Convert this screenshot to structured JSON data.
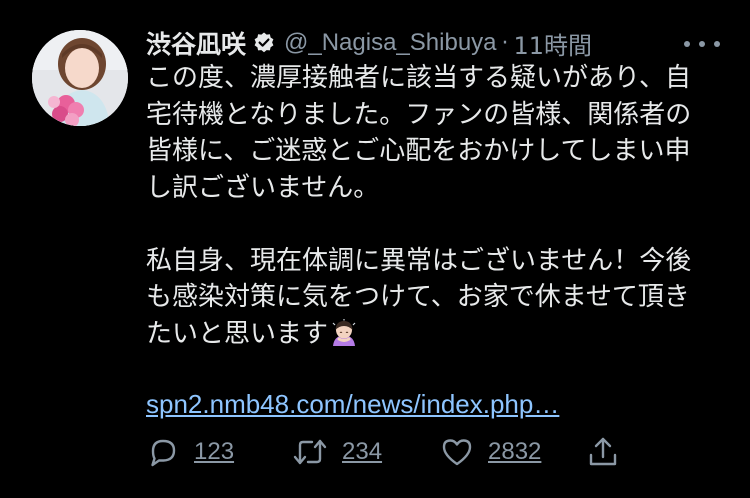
{
  "author": {
    "display_name": "渋谷凪咲",
    "handle": "@_Nagisa_Shibuya",
    "separator": "·",
    "time": "11時間",
    "avatar_icon": "profile-photo-icon",
    "verified_icon": "verified-badge-icon"
  },
  "tweet": {
    "lines": [
      "この度、濃厚接触者に該当する疑いがあり、自",
      "宅待機となりました。ファンの皆様、関係者の",
      "皆様に、ご迷惑とご心配をおかけしてしまい申",
      "し訳ございません。",
      "私自身、現在体調に異常はございません！今後",
      "も感染対策に気をつけて、お家で休ませて頂き",
      "たいと思います"
    ],
    "emoji_icon": "person-bowing-emoji",
    "link": "spn2.nmb48.com/news/index.php…"
  },
  "actions": {
    "reply": {
      "icon": "reply-icon",
      "count": "123"
    },
    "retweet": {
      "icon": "retweet-icon",
      "count": "234"
    },
    "like": {
      "icon": "heart-icon",
      "count": "2832"
    },
    "share": {
      "icon": "share-icon"
    }
  },
  "menu": {
    "icon": "more-options-icon"
  },
  "colors": {
    "background": "#000000",
    "text": "#e7e9ea",
    "muted": "#8b98a5",
    "link": "#8ec5ff"
  }
}
